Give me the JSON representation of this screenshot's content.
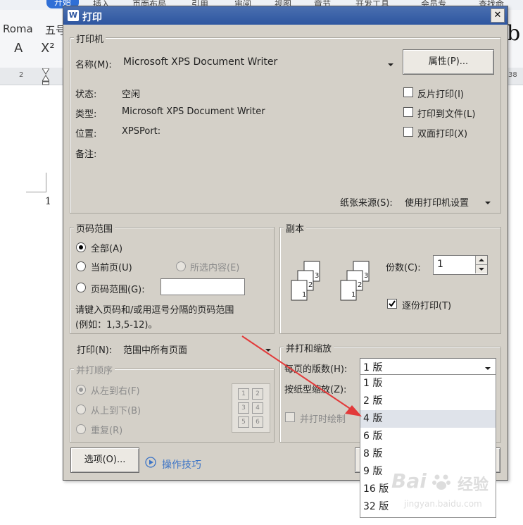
{
  "background": {
    "menu_tabs": [
      "开始",
      "插入",
      "页面布局",
      "引用",
      "审阅",
      "视图",
      "章节",
      "开发工具",
      "会员专"
    ],
    "font_name": "Roma",
    "font_size": "五号",
    "ruler_numbers": [
      "2",
      "38"
    ],
    "page_number": "1",
    "right_text": "查找命",
    "glyph_b": "b"
  },
  "dialog": {
    "title": "打印",
    "close_symbol": "✕",
    "printer_group": "打印机",
    "name_label": "名称(M):",
    "name_value": "Microsoft XPS Document Writer",
    "properties_button": "属性(P)...",
    "status_label": "状态:",
    "status_value": "空闲",
    "type_label": "类型:",
    "type_value": "Microsoft XPS Document Writer",
    "location_label": "位置:",
    "location_value": "XPSPort:",
    "comment_label": "备注:",
    "reverse_print": "反片打印(I)",
    "print_to_file": "打印到文件(L)",
    "duplex_print": "双面打印(X)",
    "paper_source_label": "纸张来源(S):",
    "paper_source_value": "使用打印机设置",
    "page_range_group": "页码范围",
    "all_label": "全部(A)",
    "current_page_label": "当前页(U)",
    "selection_label": "所选内容(E)",
    "page_range_label": "页码范围(G):",
    "page_range_hint": "请键入页码和/或用逗号分隔的页码范围",
    "page_range_example": "(例如：1,3,5-12)。",
    "copies_group": "副本",
    "copies_label": "份数(C):",
    "copies_value": "1",
    "collate_label": "逐份打印(T)",
    "print_label": "打印(N):",
    "print_value": "范围中所有页面",
    "order_group": "并打顺序",
    "left_to_right": "从左到右(F)",
    "top_to_bottom": "从上到下(B)",
    "repeat_label": "重复(R)",
    "scale_group": "并打和缩放",
    "pages_per_sheet_label": "每页的版数(H):",
    "pages_per_sheet_value": "1 版",
    "scale_to_paper_label": "按纸型缩放(Z):",
    "draw_border_label": "并打时绘制",
    "options_button": "选项(O)...",
    "tips_link": "操作技巧",
    "order_cells": [
      "1",
      "2",
      "3",
      "4",
      "5",
      "6"
    ],
    "collate_pages": [
      "3",
      "2",
      "1"
    ],
    "dropdown_options": [
      "1 版",
      "2 版",
      "4 版",
      "6 版",
      "8 版",
      "9 版",
      "16 版",
      "32 版"
    ],
    "highlighted_option": "4 版"
  },
  "watermark": {
    "brand": "Bai",
    "brand2": "经验",
    "url": "jingyan.baidu.com"
  },
  "colors": {
    "dialog_bg": "#d4d0c8",
    "title_bar": "#2e56a0",
    "arrow": "#e23a3a",
    "highlight": "#dfe3ea"
  }
}
